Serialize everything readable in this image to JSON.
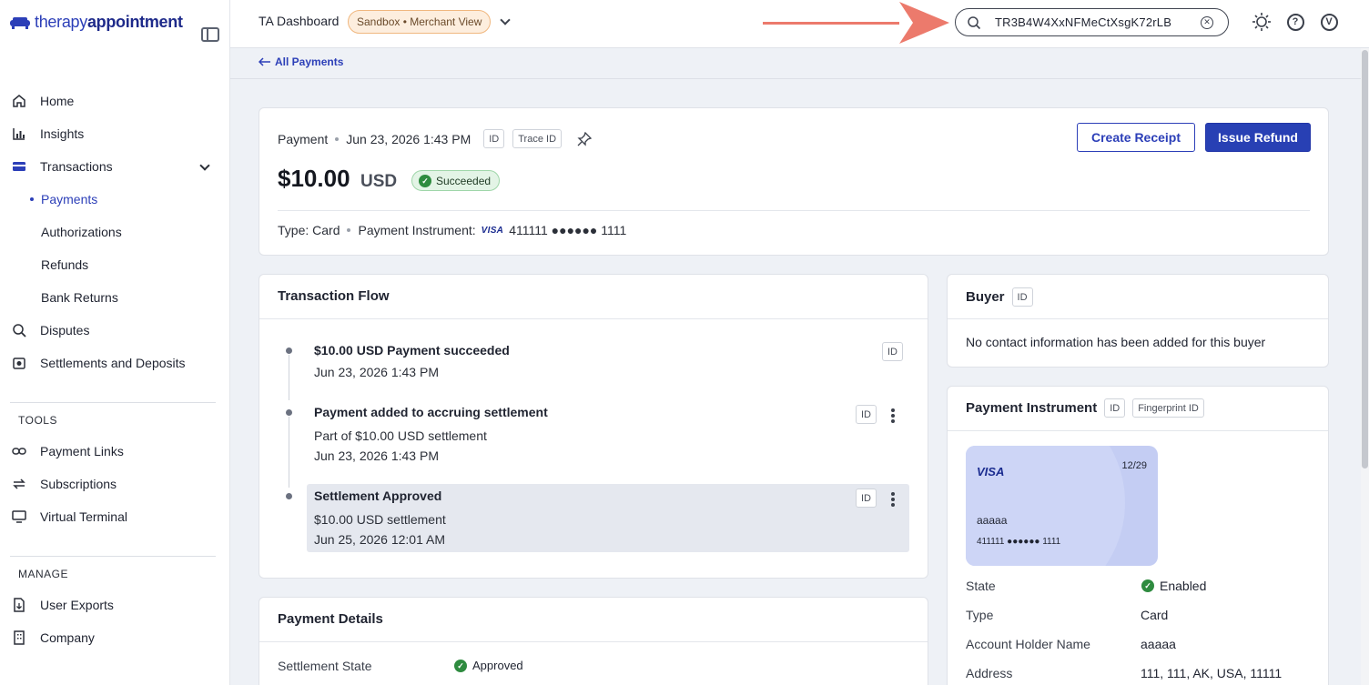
{
  "brand": {
    "light": "therapy",
    "bold": "appointment"
  },
  "sidebar": {
    "items": [
      {
        "label": "Home"
      },
      {
        "label": "Insights"
      },
      {
        "label": "Transactions"
      },
      {
        "label": "Payments"
      },
      {
        "label": "Authorizations"
      },
      {
        "label": "Refunds"
      },
      {
        "label": "Bank Returns"
      },
      {
        "label": "Disputes"
      },
      {
        "label": "Settlements and Deposits"
      }
    ],
    "tools_label": "TOOLS",
    "tools": [
      {
        "label": "Payment Links"
      },
      {
        "label": "Subscriptions"
      },
      {
        "label": "Virtual Terminal"
      }
    ],
    "manage_label": "MANAGE",
    "manage": [
      {
        "label": "User Exports"
      },
      {
        "label": "Company"
      }
    ]
  },
  "topbar": {
    "title": "TA Dashboard",
    "env_badge": "Sandbox • Merchant View",
    "search_value": "TR3B4W4XxNFMeCtXsgK72rLB"
  },
  "subbar": {
    "back_label": "All Payments"
  },
  "payment": {
    "label": "Payment",
    "datetime": "Jun 23, 2026 1:43 PM",
    "id_chip": "ID",
    "trace_chip": "Trace ID",
    "amount": "$10.00",
    "currency": "USD",
    "status": "Succeeded",
    "type_line": "Type: Card",
    "instrument_label": "Payment Instrument:",
    "instrument_brand": "VISA",
    "instrument_number": "411111 ●●●●●● 1111",
    "create_receipt": "Create Receipt",
    "issue_refund": "Issue Refund"
  },
  "flow": {
    "title": "Transaction Flow",
    "items": [
      {
        "title": "$10.00 USD Payment succeeded",
        "lines": [
          "Jun 23, 2026 1:43 PM"
        ],
        "chip": "ID"
      },
      {
        "title": "Payment added to accruing settlement",
        "lines": [
          "Part of $10.00 USD settlement",
          "Jun 23, 2026 1:43 PM"
        ],
        "chip": "ID"
      },
      {
        "title": "Settlement Approved",
        "lines": [
          "$10.00 USD settlement",
          "Jun 25, 2026 12:01 AM"
        ],
        "chip": "ID"
      }
    ]
  },
  "details": {
    "title": "Payment Details",
    "settlement_state_label": "Settlement State",
    "settlement_state_value": "Approved"
  },
  "buyer": {
    "title": "Buyer",
    "chip": "ID",
    "empty_text": "No contact information has been added for this buyer"
  },
  "instrument": {
    "title": "Payment Instrument",
    "chip": "ID",
    "fingerprint_chip": "Fingerprint ID",
    "card": {
      "brand": "VISA",
      "expiry": "12/29",
      "name": "aaaaa",
      "number": "411111 ●●●●●● 1111"
    },
    "rows": [
      {
        "label": "State",
        "value": "Enabled"
      },
      {
        "label": "Type",
        "value": "Card"
      },
      {
        "label": "Account Holder Name",
        "value": "aaaaa"
      },
      {
        "label": "Address",
        "value": "111, 111, AK, USA, 11111"
      }
    ]
  },
  "colors": {
    "accent": "#2840b4",
    "success": "#2e8b3f",
    "annotation_arrow": "#ec7a6c"
  }
}
